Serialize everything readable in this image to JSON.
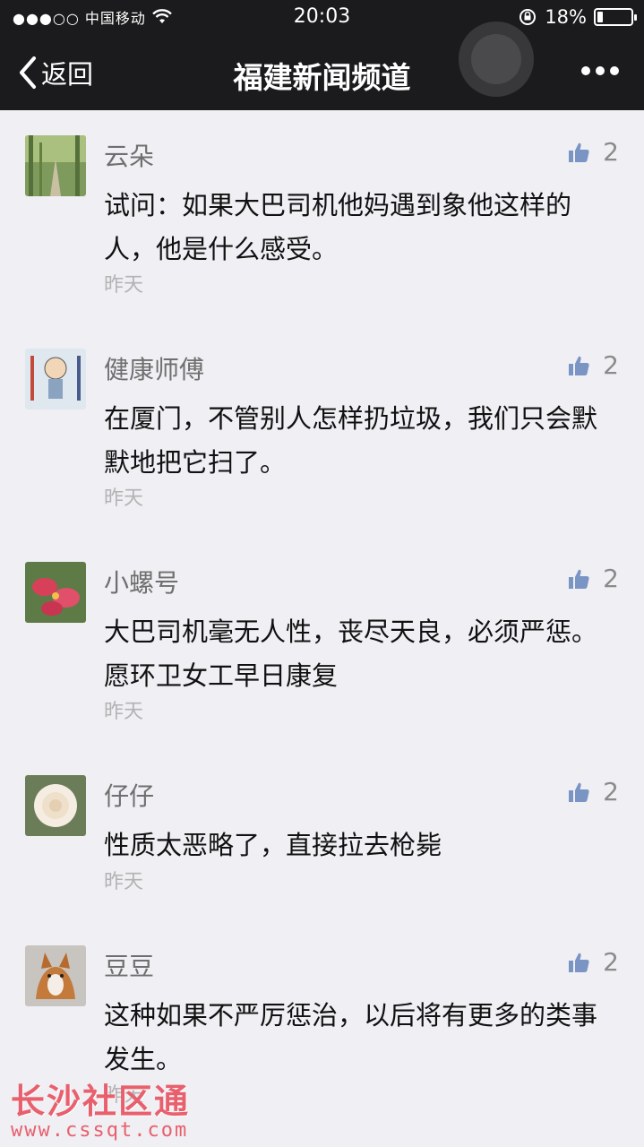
{
  "status_bar": {
    "carrier": "●●●○○ 中国移动",
    "time": "20:03",
    "battery_text": "18%",
    "battery_level": 0.18
  },
  "nav": {
    "back_label": "返回",
    "title": "福建新闻频道"
  },
  "comments": [
    {
      "name": "云朵",
      "likes": "2",
      "text": "试问：如果大巴司机他妈遇到象他这样的人，他是什么感受。",
      "time": "昨天"
    },
    {
      "name": "健康师傅",
      "likes": "2",
      "text": "在厦门，不管别人怎样扔垃圾，我们只会默默地把它扫了。",
      "time": "昨天"
    },
    {
      "name": "小螺号",
      "likes": "2",
      "text": "大巴司机毫无人性，丧尽天良，必须严惩。　愿环卫女工早日康复",
      "time": "昨天"
    },
    {
      "name": "仔仔",
      "likes": "2",
      "text": "性质太恶略了，直接拉去枪毙",
      "time": "昨天"
    },
    {
      "name": "豆豆",
      "likes": "2",
      "text": "这种如果不严厉惩治，以后将有更多的类事发生。",
      "time": "昨天"
    }
  ],
  "watermark": {
    "title": "长沙社区通",
    "url": "www.cssqt.com"
  },
  "colors": {
    "nav_background": "#1b1b1d",
    "page_background": "#efeff4",
    "like_icon": "#7a94c4",
    "watermark": "#e8606d"
  }
}
